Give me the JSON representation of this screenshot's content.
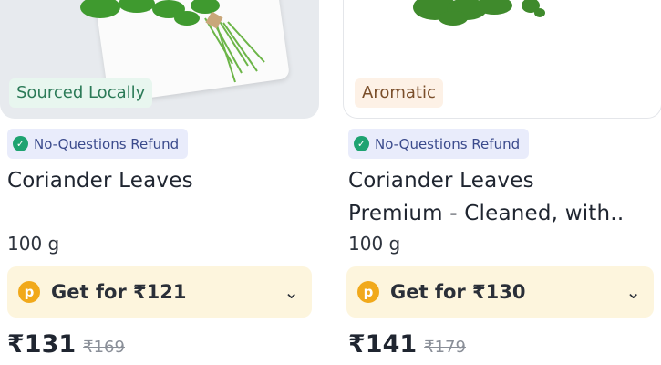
{
  "products": [
    {
      "tag": "Sourced Locally",
      "refund": "No-Questions Refund",
      "title_lines": [
        "Coriander Leaves",
        ""
      ],
      "qty": "100 g",
      "offer": "Get for ₹121",
      "price": "₹131",
      "mrp": "₹169"
    },
    {
      "tag": "Aromatic",
      "refund": "No-Questions Refund",
      "title_lines": [
        "Coriander Leaves",
        "Premium - Cleaned, with.."
      ],
      "qty": "100 g",
      "offer": "Get for ₹130",
      "price": "₹141",
      "mrp": "₹179"
    }
  ],
  "icons": {
    "check": "check-circle-icon",
    "coin": "p-coin-icon",
    "chevron": "chevron-down-icon"
  },
  "colors": {
    "coin": "#f1a91b",
    "check": "#1ea371",
    "offer_bg": "#fdf5dd",
    "refund_bg": "#e9ecfb"
  }
}
